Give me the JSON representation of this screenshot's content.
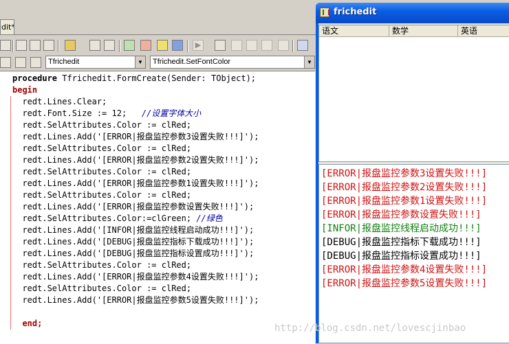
{
  "ide": {
    "tab_label": "dit*",
    "combo_class": "Tfrichedit",
    "combo_method": "Tfrichedit.SetFontColor",
    "code": [
      {
        "parts": [
          {
            "t": "procedure",
            "c": "kw"
          },
          {
            "t": " Tfrichedit.FormCreate(Sender: TObject);",
            "c": ""
          }
        ]
      },
      {
        "parts": [
          {
            "t": "begin",
            "c": "kw2"
          }
        ]
      },
      {
        "parts": [
          {
            "t": "  redt.Lines.Clear;",
            "c": ""
          }
        ]
      },
      {
        "parts": [
          {
            "t": "  redt.Font.Size := 12;   ",
            "c": ""
          },
          {
            "t": "//设置字体大小",
            "c": "cm"
          }
        ]
      },
      {
        "parts": [
          {
            "t": "  redt.SelAttributes.Color := clRed;",
            "c": ""
          }
        ]
      },
      {
        "parts": [
          {
            "t": "  redt.Lines.Add('[ERROR|报盘监控参数3设置失败!!!]');",
            "c": ""
          }
        ]
      },
      {
        "parts": [
          {
            "t": "  redt.SelAttributes.Color := clRed;",
            "c": ""
          }
        ]
      },
      {
        "parts": [
          {
            "t": "  redt.Lines.Add('[ERROR|报盘监控参数2设置失败!!!]');",
            "c": ""
          }
        ]
      },
      {
        "parts": [
          {
            "t": "  redt.SelAttributes.Color := clRed;",
            "c": ""
          }
        ]
      },
      {
        "parts": [
          {
            "t": "  redt.Lines.Add('[ERROR|报盘监控参数1设置失败!!!]');",
            "c": ""
          }
        ]
      },
      {
        "parts": [
          {
            "t": "  redt.SelAttributes.Color := clRed;",
            "c": ""
          }
        ]
      },
      {
        "parts": [
          {
            "t": "  redt.Lines.Add('[ERROR|报盘监控参数设置失败!!!]');",
            "c": ""
          }
        ]
      },
      {
        "parts": [
          {
            "t": "  redt.SelAttributes.Color:=clGreen; ",
            "c": ""
          },
          {
            "t": "//绿色",
            "c": "cm"
          }
        ]
      },
      {
        "parts": [
          {
            "t": "  redt.Lines.Add('[INFOR|报盘监控线程启动成功!!!]');",
            "c": ""
          }
        ]
      },
      {
        "parts": [
          {
            "t": "  redt.Lines.Add('[DEBUG|报盘监控指标下载成功!!!]');",
            "c": ""
          }
        ]
      },
      {
        "parts": [
          {
            "t": "  redt.Lines.Add('[DEBUG|报盘监控指标设置成功!!!]');",
            "c": ""
          }
        ]
      },
      {
        "parts": [
          {
            "t": "  redt.SelAttributes.Color := clRed;",
            "c": ""
          }
        ]
      },
      {
        "parts": [
          {
            "t": "  redt.Lines.Add('[ERROR|报盘监控参数4设置失败!!!]');",
            "c": ""
          }
        ]
      },
      {
        "parts": [
          {
            "t": "  redt.SelAttributes.Color := clRed;",
            "c": ""
          }
        ]
      },
      {
        "parts": [
          {
            "t": "  redt.Lines.Add('[ERROR|报盘监控参数5设置失败!!!]');",
            "c": ""
          }
        ]
      },
      {
        "parts": [
          {
            "t": "",
            "c": ""
          }
        ]
      },
      {
        "parts": [
          {
            "t": "  end;",
            "c": "kw2"
          }
        ]
      }
    ]
  },
  "app": {
    "title": "frichedit",
    "grid_headers": [
      "语文",
      "数学",
      "英语"
    ],
    "colors": {
      "red": "#d01010",
      "green": "#108010",
      "black": "#000000"
    },
    "log_lines": [
      {
        "text": "[ERROR|报盘监控参数3设置失败!!!]",
        "color": "red"
      },
      {
        "text": "[ERROR|报盘监控参数2设置失败!!!]",
        "color": "red"
      },
      {
        "text": "[ERROR|报盘监控参数1设置失败!!!]",
        "color": "red"
      },
      {
        "text": "[ERROR|报盘监控参数设置失败!!!]",
        "color": "red"
      },
      {
        "text": "[INFOR|报盘监控线程启动成功!!!]",
        "color": "green"
      },
      {
        "text": "[DEBUG|报盘监控指标下载成功!!!]",
        "color": "black"
      },
      {
        "text": "[DEBUG|报盘监控指标设置成功!!!]",
        "color": "black"
      },
      {
        "text": "[ERROR|报盘监控参数4设置失败!!!]",
        "color": "red"
      },
      {
        "text": "[ERROR|报盘监控参数5设置失败!!!]",
        "color": "red"
      }
    ]
  },
  "watermark": "http://blog.csdn.net/lovescjinbao"
}
